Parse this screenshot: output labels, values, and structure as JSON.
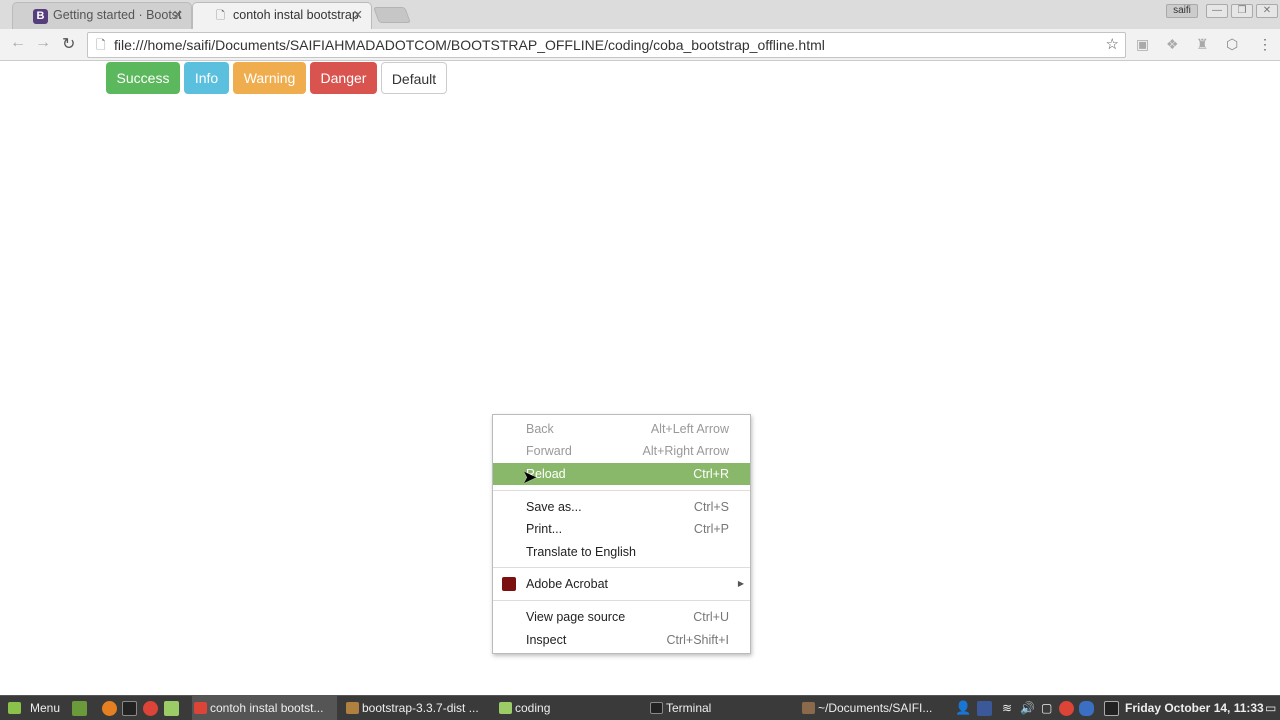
{
  "browser": {
    "tabs": [
      {
        "title": "Getting started · Bootst",
        "icon": "B"
      },
      {
        "title": "contoh instal bootstrap",
        "icon": "page-icon"
      }
    ],
    "url": "file:///home/saifi/Documents/SAIFIAHMADADOTCOM/BOOTSTRAP_OFFLINE/coding/coba_bootstrap_offline.html",
    "profile": "saifi"
  },
  "page": {
    "buttons": [
      {
        "label": "Success",
        "color": "#5cb85c"
      },
      {
        "label": "Info",
        "color": "#5bc0de"
      },
      {
        "label": "Warning",
        "color": "#f0ad4e"
      },
      {
        "label": "Danger",
        "color": "#d9534f"
      },
      {
        "label": "Default",
        "color": "#ffffff"
      }
    ]
  },
  "context_menu": {
    "items": [
      {
        "label": "Back",
        "shortcut": "Alt+Left Arrow"
      },
      {
        "label": "Forward",
        "shortcut": "Alt+Right Arrow"
      },
      {
        "label": "Reload",
        "shortcut": "Ctrl+R"
      },
      {
        "label": "Save as...",
        "shortcut": "Ctrl+S"
      },
      {
        "label": "Print...",
        "shortcut": "Ctrl+P"
      },
      {
        "label": "Translate to English",
        "shortcut": ""
      },
      {
        "label": "Adobe Acrobat",
        "shortcut": ""
      },
      {
        "label": "View page source",
        "shortcut": "Ctrl+U"
      },
      {
        "label": "Inspect",
        "shortcut": "Ctrl+Shift+I"
      }
    ]
  },
  "taskbar": {
    "menu": "Menu",
    "windows": [
      "contoh instal bootst...",
      "bootstrap-3.3.7-dist ...",
      "coding",
      "Terminal",
      "~/Documents/SAIFI..."
    ],
    "clock": "Friday October 14, 11:33"
  }
}
